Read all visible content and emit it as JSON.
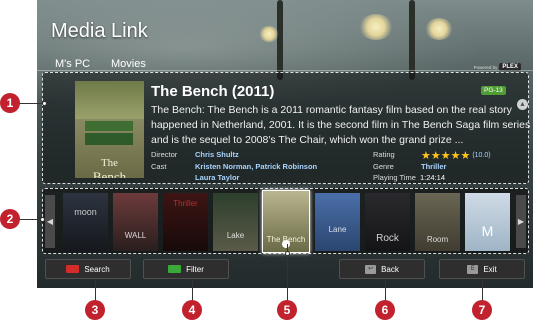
{
  "app": {
    "title": "Media Link",
    "breadcrumb": [
      "M's PC",
      "Movies"
    ],
    "powered_by": "Powered by",
    "brand": "PLEX"
  },
  "movie": {
    "title": "The Bench (2011)",
    "rating_badge": "PG-13",
    "synopsis": "The Bench: The Bench is a 2011 romantic fantasy film based on the real story happened in Netherland, 2001. It is the second film in The Bench Saga film series and is the sequel to 2008's The Chair, which won the grand prize ...",
    "poster_title": "The\nBench",
    "director_label": "Director",
    "director": "Chris Shultz",
    "cast_label": "Cast",
    "cast": [
      "Kristen Norman, Patrick Robinson",
      "Laura Taylor"
    ],
    "rating_label": "Rating",
    "stars": "★★★★★",
    "stars_value": 5,
    "rating_score": "(10.0)",
    "genre_label": "Genre",
    "genre": "Thriller",
    "playing_time_label": "Playing Time",
    "playing_time": "1:24:14"
  },
  "carousel": {
    "thumbnails": [
      {
        "label": "moon"
      },
      {
        "label": "WALL"
      },
      {
        "label": "Thriller"
      },
      {
        "label": "Lake"
      },
      {
        "label": "The Bench",
        "selected": true
      },
      {
        "label": "Lane"
      },
      {
        "label": "Rock"
      },
      {
        "label": "Room"
      },
      {
        "label": "M"
      }
    ]
  },
  "buttons": {
    "search": "Search",
    "filter": "Filter",
    "back": "Back",
    "exit": "Exit"
  },
  "callouts": [
    "1",
    "2",
    "3",
    "4",
    "5",
    "6",
    "7"
  ],
  "colors": {
    "callout": "#c1222e",
    "search_key": "#d62b2b",
    "filter_key": "#3aa93a",
    "link": "#a9d4ff",
    "badge": "#4f9e34",
    "stars": "#ffc51a"
  }
}
